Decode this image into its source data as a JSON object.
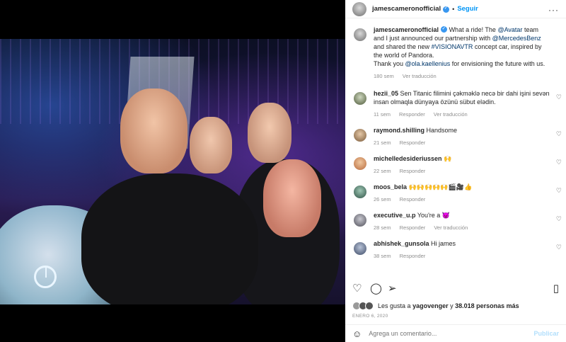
{
  "post": {
    "author": "jamescameronofficial",
    "follow_label": "Seguir",
    "more_label": "···",
    "caption_parts": {
      "p1": "What a ride! The ",
      "m1": "@Avatar",
      "p2": " team and I just announced our partnership with ",
      "m2": "@MercedesBenz",
      "p3": " and shared the new ",
      "m3": "#VISIONAVTR",
      "p4": " concept car, inspired by the world of Pandora.",
      "p5": "Thank you ",
      "m4": "@ola.kaellenius",
      "p6": " for envisioning the future with us."
    },
    "time": "180 sem",
    "translate": "Ver traducción",
    "likes_prefix": "Les gusta a",
    "likes_user": "yagovenger",
    "likes_mid": "y",
    "likes_count": "38.018 personas más",
    "date": "ENERO 6, 2020",
    "comment_placeholder": "Agrega un comentario...",
    "publish_label": "Publicar"
  },
  "comments": [
    {
      "user": "hezii_05",
      "text": "Sen Titanic filimini çəkməklə necə bir dahi işini sevən insan olmaqla dünyaya özünü sübut elədin.",
      "time": "11 sem",
      "reply": "Responder",
      "translate": "Ver traducción"
    },
    {
      "user": "raymond.shilling",
      "text": "Handsome",
      "time": "21 sem",
      "reply": "Responder",
      "translate": ""
    },
    {
      "user": "michelledesideriussen",
      "text": "🙌",
      "time": "22 sem",
      "reply": "Responder",
      "translate": ""
    },
    {
      "user": "moos_bela",
      "text": "🙌🙌🙌🙌🙌🎬🎥👍",
      "time": "26 sem",
      "reply": "Responder",
      "translate": ""
    },
    {
      "user": "executive_u.p",
      "text": "You're a 👿",
      "time": "28 sem",
      "reply": "Responder",
      "translate": "Ver traducción"
    },
    {
      "user": "abhishek_gunsola",
      "text": "Hi james",
      "time": "38 sem",
      "reply": "Responder",
      "translate": ""
    }
  ],
  "icons": {
    "heart": "heart-icon",
    "comment": "comment-icon",
    "share": "share-icon",
    "save": "bookmark-icon",
    "emoji": "emoji-icon",
    "more": "more-options-icon"
  },
  "colors": {
    "link": "#00376b",
    "follow": "#0095f6",
    "verified": "#3897f0",
    "muted": "#8e8e8e"
  }
}
